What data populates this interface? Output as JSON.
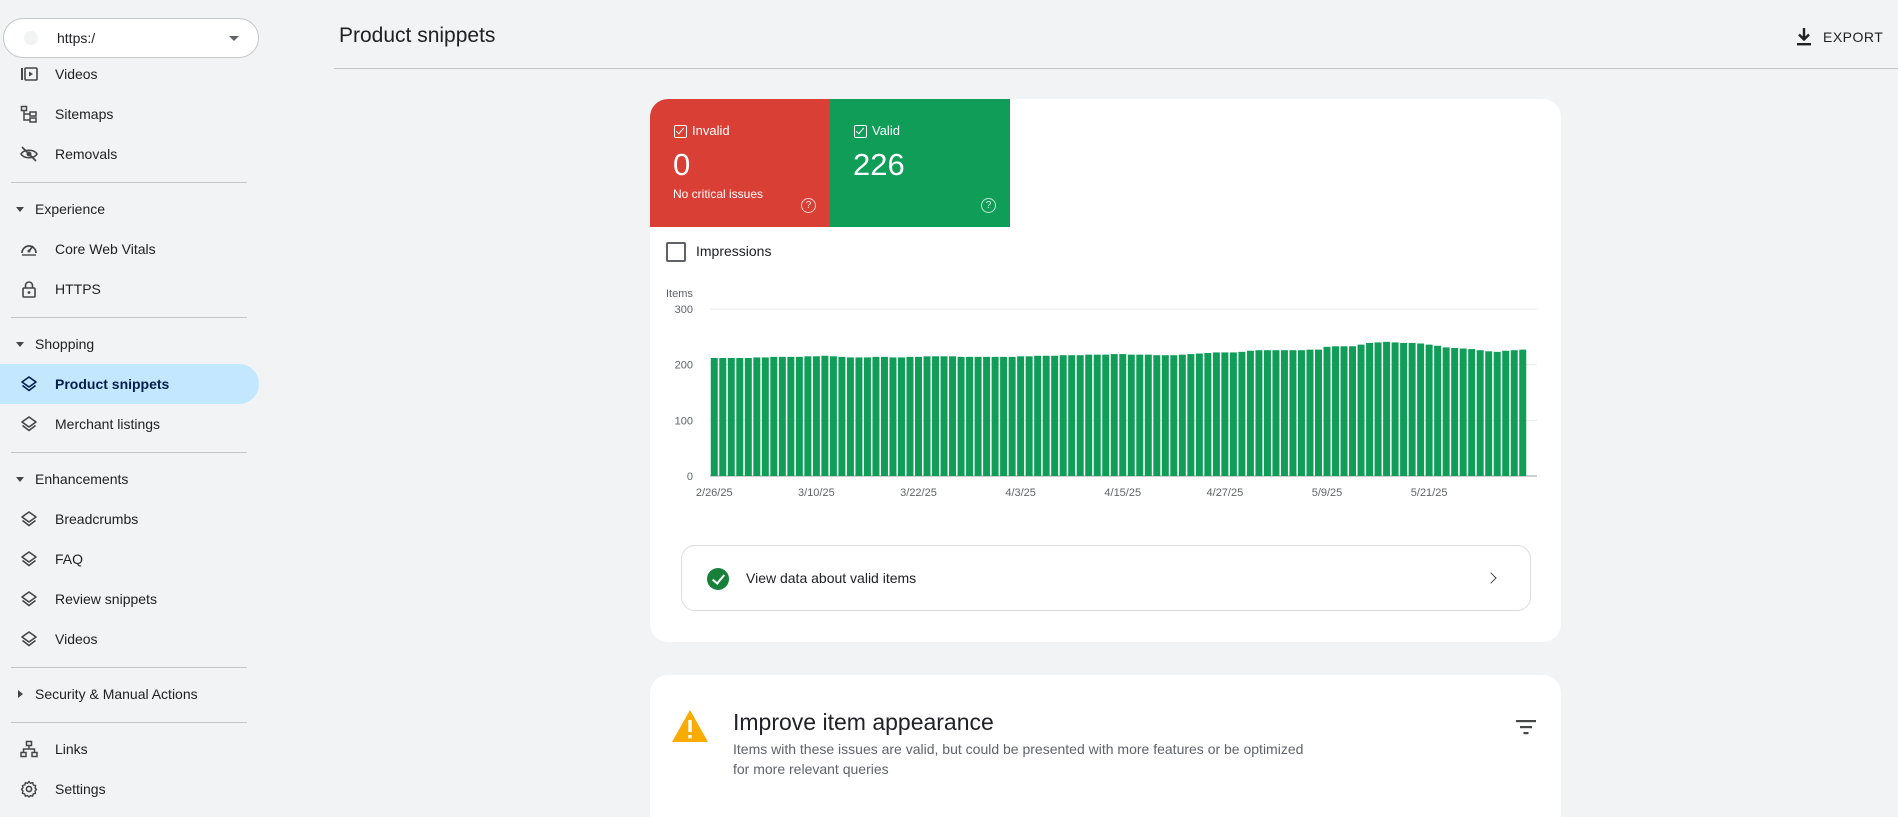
{
  "property": {
    "url": "https:/"
  },
  "sidebar": {
    "items_top": [
      {
        "label": "Videos",
        "icon": "video-pages-icon"
      },
      {
        "label": "Sitemaps",
        "icon": "sitemap-icon"
      },
      {
        "label": "Removals",
        "icon": "visibility-off-icon"
      }
    ],
    "sections": {
      "experience": "Experience",
      "shopping": "Shopping",
      "enhancements": "Enhancements",
      "security": "Security & Manual Actions"
    },
    "experience_items": [
      {
        "label": "Core Web Vitals",
        "icon": "speed-icon"
      },
      {
        "label": "HTTPS",
        "icon": "lock-icon"
      }
    ],
    "shopping_items": [
      {
        "label": "Product snippets",
        "icon": "layers-icon",
        "active": true
      },
      {
        "label": "Merchant listings",
        "icon": "layers-icon"
      }
    ],
    "enhancement_items": [
      {
        "label": "Breadcrumbs",
        "icon": "layers-icon"
      },
      {
        "label": "FAQ",
        "icon": "layers-icon"
      },
      {
        "label": "Review snippets",
        "icon": "layers-icon"
      },
      {
        "label": "Videos",
        "icon": "layers-icon"
      }
    ],
    "bottom_items": [
      {
        "label": "Links",
        "icon": "links-icon"
      },
      {
        "label": "Settings",
        "icon": "settings-icon"
      }
    ]
  },
  "header": {
    "title": "Product snippets",
    "export_label": "EXPORT"
  },
  "summary": {
    "invalid": {
      "label": "Invalid",
      "value": "0",
      "sub": "No critical issues",
      "color": "#d93f35"
    },
    "valid": {
      "label": "Valid",
      "value": "226",
      "color": "#0f9d58"
    }
  },
  "impressions_label": "Impressions",
  "chart_data": {
    "type": "bar",
    "ylabel": "Items",
    "ylim": [
      0,
      300
    ],
    "yticks": [
      0,
      100,
      200,
      300
    ],
    "grid": true,
    "xtick_labels": [
      "2/26/25",
      "3/10/25",
      "3/22/25",
      "4/3/25",
      "4/15/25",
      "4/27/25",
      "5/9/25",
      "5/21/25"
    ],
    "xtick_indices": [
      0,
      12,
      24,
      36,
      48,
      60,
      72,
      84
    ],
    "color": "#0f9d58",
    "values": [
      212,
      212,
      212,
      212,
      212,
      213,
      213,
      214,
      214,
      214,
      214,
      215,
      215,
      216,
      215,
      214,
      213,
      213,
      213,
      214,
      214,
      213,
      213,
      214,
      214,
      215,
      215,
      215,
      215,
      214,
      214,
      214,
      214,
      214,
      214,
      214,
      215,
      215,
      216,
      216,
      216,
      217,
      217,
      217,
      218,
      218,
      218,
      219,
      219,
      218,
      218,
      218,
      217,
      217,
      217,
      218,
      219,
      220,
      221,
      222,
      222,
      222,
      223,
      225,
      226,
      226,
      226,
      226,
      226,
      226,
      227,
      227,
      232,
      233,
      233,
      233,
      236,
      239,
      240,
      241,
      240,
      239,
      239,
      238,
      236,
      234,
      231,
      230,
      229,
      228,
      226,
      224,
      223,
      225,
      226,
      227
    ]
  },
  "valid_link_label": "View data about valid items",
  "improve": {
    "title": "Improve item appearance",
    "description": "Items with these issues are valid, but could be presented with more features or be optimized for more relevant queries"
  }
}
